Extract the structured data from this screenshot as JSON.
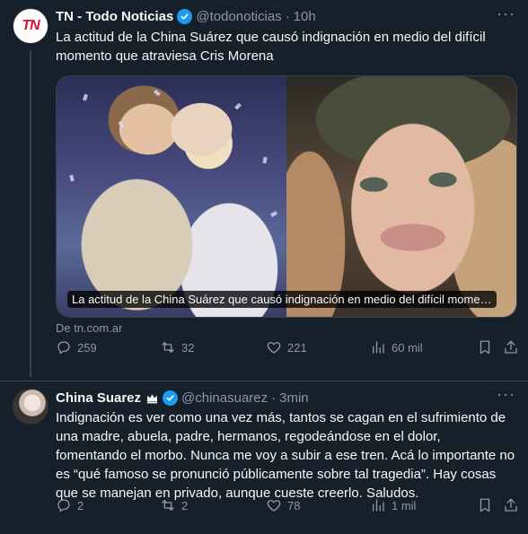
{
  "tweets": [
    {
      "author_name": "TN - Todo Noticias",
      "handle": "@todonoticias",
      "separator": "·",
      "time": "10h",
      "avatar_text": "TN",
      "text": "La actitud de la China Suárez que causó indignación en medio del difícil momento que atraviesa Cris Morena",
      "card_caption": "La actitud de la China Suárez que causó indignación en medio del difícil mome…",
      "card_source": "De tn.com.ar",
      "stats": {
        "replies": "259",
        "retweets": "32",
        "likes": "221",
        "views": "60 mil"
      }
    },
    {
      "author_name": "China Suarez",
      "handle": "@chinasuarez",
      "separator": "·",
      "time": "3min",
      "text": "Indignación es ver como una vez más, tantos se cagan en el sufrimiento de una madre, abuela, padre, hermanos, regodeándose en el dolor, fomentando el morbo. Nunca me voy a subir a ese tren. Acá lo importante no es “qué famoso se pronunció públicamente sobre tal tragedia”. Hay cosas que se manejan en privado, aunque cueste creerlo. Saludos.",
      "stats": {
        "replies": "2",
        "retweets": "2",
        "likes": "78",
        "views": "1 mil"
      }
    }
  ],
  "icons": {
    "verified": "verified-badge-icon",
    "crown": "crown-icon",
    "more": "more-icon",
    "reply": "reply-icon",
    "retweet": "retweet-icon",
    "like": "heart-icon",
    "views": "views-icon",
    "bookmark": "bookmark-icon",
    "share": "share-icon"
  },
  "colors": {
    "background": "#15202b",
    "text": "#f7f9f9",
    "muted": "#8b98a5",
    "verified": "#1d9bf0",
    "border": "#38444d",
    "tn_red": "#e0102d"
  }
}
